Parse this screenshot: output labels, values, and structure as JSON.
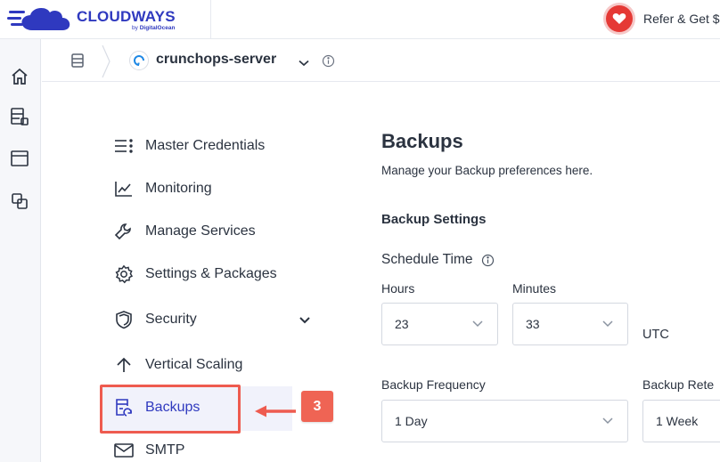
{
  "brand": {
    "name": "CLOUDWAYS",
    "byline_prefix": "by",
    "byline_company": "DigitalOcean",
    "color": "#2f39bf"
  },
  "header": {
    "refer_label": "Refer & Get $"
  },
  "breadcrumb": {
    "server_name": "crunchops-server"
  },
  "menu": {
    "items": [
      {
        "label": "Master Credentials",
        "icon": "list-icon"
      },
      {
        "label": "Monitoring",
        "icon": "chart-icon"
      },
      {
        "label": "Manage Services",
        "icon": "wrench-icon"
      },
      {
        "label": "Settings & Packages",
        "icon": "gear-icon"
      },
      {
        "label": "Security",
        "icon": "shield-icon"
      },
      {
        "label": "Vertical Scaling",
        "icon": "arrow-up-icon"
      },
      {
        "label": "Backups",
        "icon": "backup-icon"
      },
      {
        "label": "SMTP",
        "icon": "mail-icon"
      }
    ],
    "active": "Backups"
  },
  "callout": {
    "step": "3",
    "color": "#ee5b4f"
  },
  "content": {
    "title": "Backups",
    "description": "Manage your Backup preferences here.",
    "section_title": "Backup Settings",
    "schedule_label": "Schedule Time",
    "hours_label": "Hours",
    "hours_value": "23",
    "minutes_label": "Minutes",
    "minutes_value": "33",
    "timezone": "UTC",
    "frequency_label": "Backup Frequency",
    "frequency_value": "1 Day",
    "retention_label": "Backup Rete",
    "retention_value": "1 Week"
  }
}
